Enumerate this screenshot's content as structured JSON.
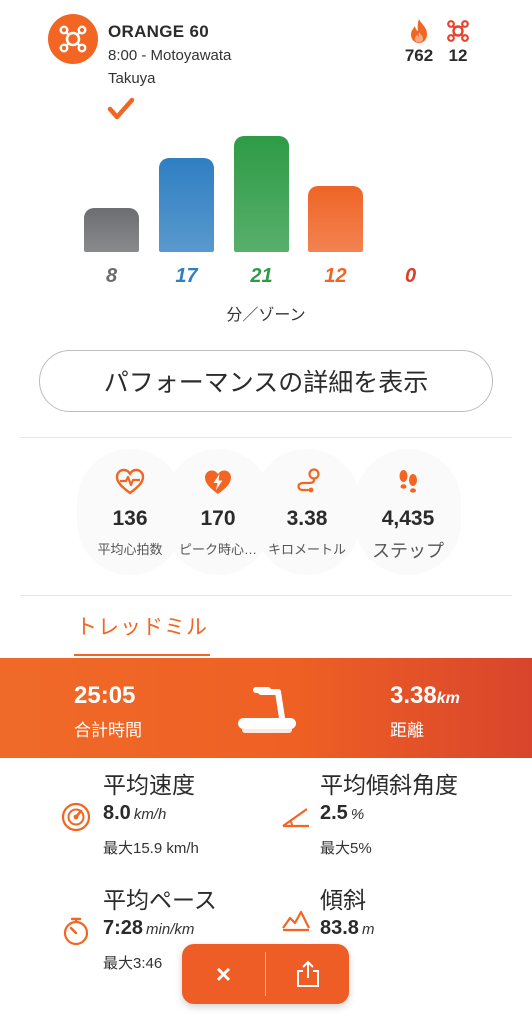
{
  "header": {
    "class_name": "ORANGE 60",
    "schedule": "8:00 - Motoyawata",
    "coach": "Takuya",
    "calories": "762",
    "splat_points": "12"
  },
  "zones": {
    "values": [
      "8",
      "17",
      "21",
      "12",
      "0"
    ],
    "colors": [
      "#6b6d70",
      "#2f7fc1",
      "#2e9b46",
      "#ef6426",
      "#d8402a"
    ],
    "caption": "分／ゾーン"
  },
  "chart_data": {
    "type": "bar",
    "categories": [
      "gray",
      "blue",
      "green",
      "orange",
      "red"
    ],
    "values": [
      8,
      17,
      21,
      12,
      0
    ],
    "xlabel": "分／ゾーン"
  },
  "performance_button": "パフォーマンスの詳細を表示",
  "metrics": [
    {
      "value": "136",
      "label": "平均心拍数",
      "icon": "heart-pulse-icon"
    },
    {
      "value": "170",
      "label": "ピーク時心…",
      "icon": "heart-bolt-icon"
    },
    {
      "value": "3.38",
      "label": "キロメートル",
      "icon": "route-icon"
    },
    {
      "value": "4,435",
      "label": "ステップ",
      "icon": "footsteps-icon"
    }
  ],
  "tab": {
    "label": "トレッドミル"
  },
  "banner": {
    "total_time": "25:05",
    "total_time_label": "合計時間",
    "distance": "3.38",
    "distance_unit": "km",
    "distance_label": "距離"
  },
  "details": {
    "avg_speed": {
      "title": "平均速度",
      "value": "8.0",
      "unit": "km/h",
      "max": "最大15.9 km/h"
    },
    "avg_incline": {
      "title": "平均傾斜角度",
      "value": "2.5",
      "unit": "%",
      "max": "最大5%"
    },
    "avg_pace": {
      "title": "平均ペース",
      "value": "7:28",
      "unit": "min/km",
      "max": "最大3:46"
    },
    "elevation": {
      "title": "傾斜",
      "value": "83.8",
      "unit": "m"
    }
  },
  "float_bar": {
    "close": "×"
  }
}
